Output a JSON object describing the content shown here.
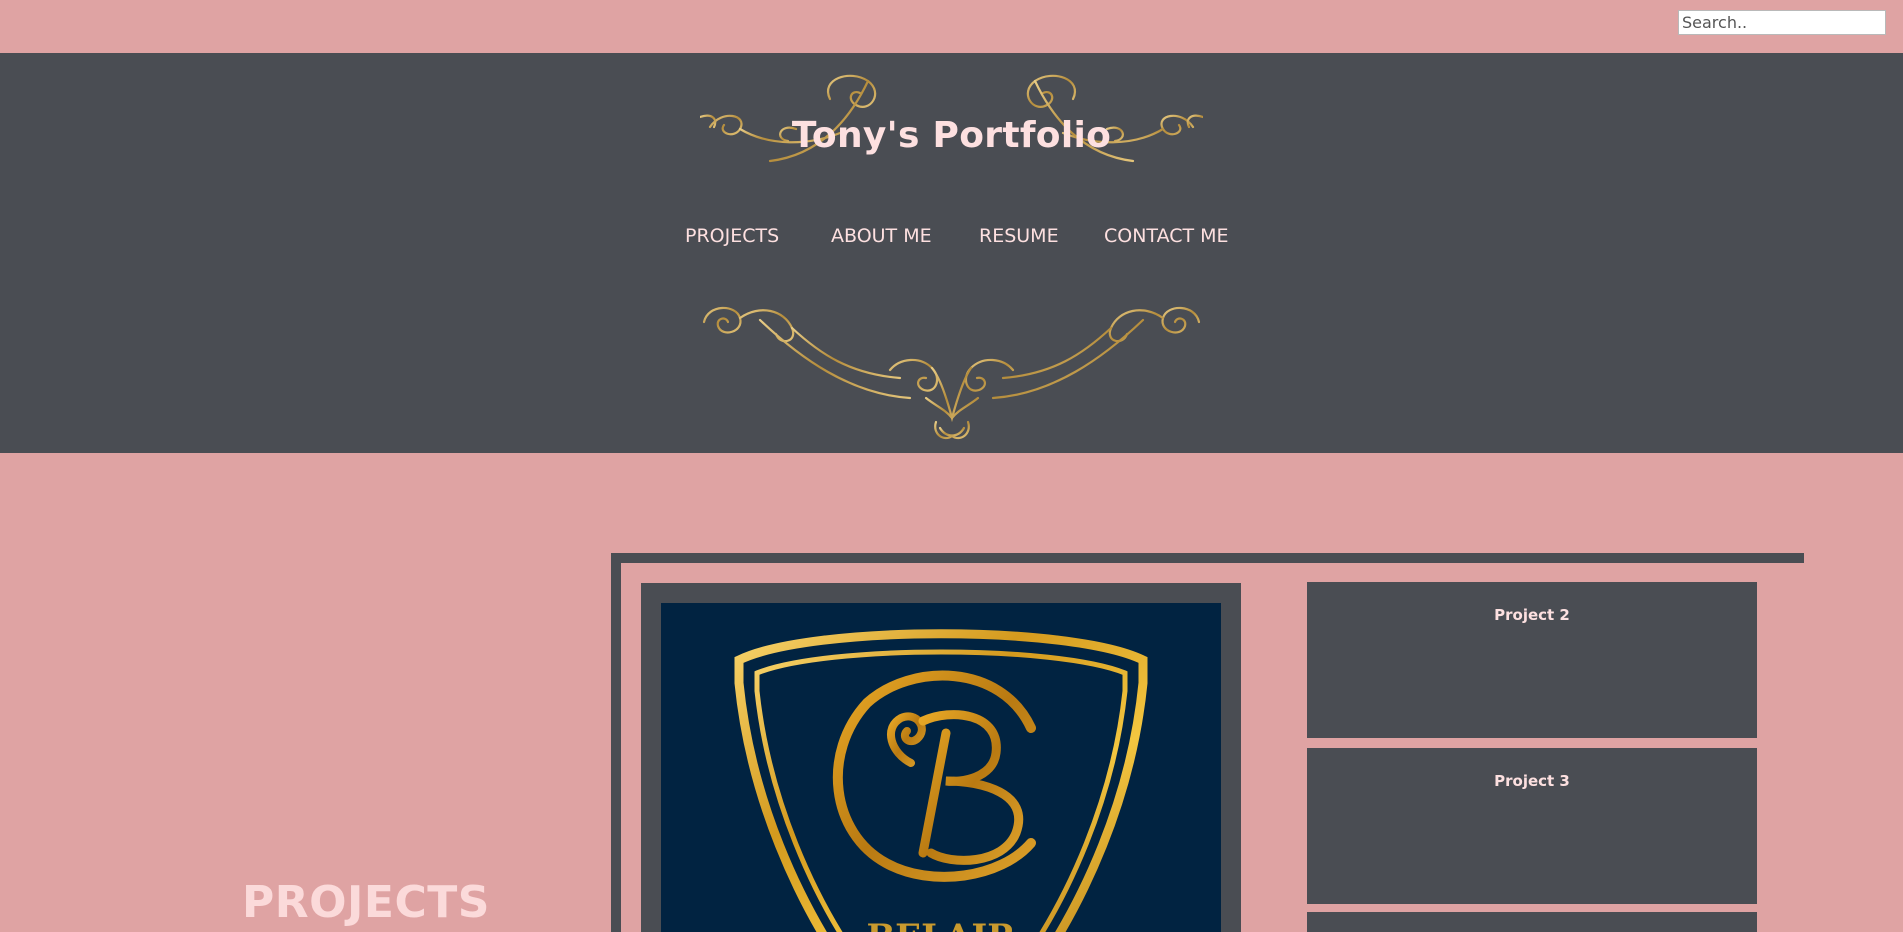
{
  "search": {
    "placeholder": "Search.."
  },
  "header": {
    "title": "Tony's Portfolio",
    "nav": [
      {
        "label": "PROJECTS"
      },
      {
        "label": "ABOUT ME"
      },
      {
        "label": "RESUME"
      },
      {
        "label": "CONTACT ME"
      }
    ],
    "ornament_icon": "gold-flourish-icon"
  },
  "projects_section": {
    "heading": "PROJECTS",
    "featured": {
      "logo_icon": "gold-shield-b-logo",
      "logo_text": "BELAIR"
    },
    "cards": [
      {
        "title": "Project 2"
      },
      {
        "title": "Project 3"
      },
      {
        "title": ""
      }
    ]
  },
  "colors": {
    "page_background": "#dfa3a3",
    "header_background": "#4a4d53",
    "text_light": "#fde0e0",
    "gold": "#c9a24a",
    "logo_background": "#012341"
  }
}
